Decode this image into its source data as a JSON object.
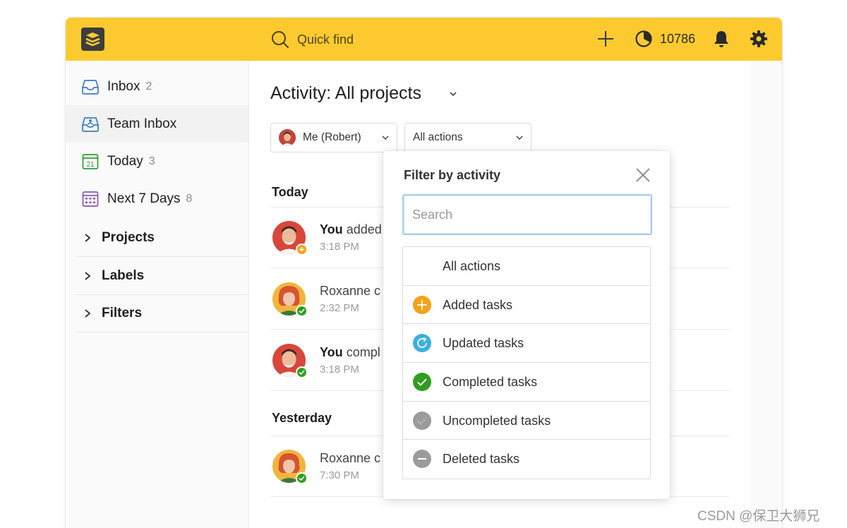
{
  "topbar": {
    "search_label": "Quick find",
    "karma_score": "10786"
  },
  "sidebar": {
    "items": [
      {
        "label": "Inbox",
        "count": "2",
        "icon": "inbox-icon"
      },
      {
        "label": "Team Inbox",
        "count": "",
        "icon": "team-inbox-icon"
      },
      {
        "label": "Today",
        "count": "3",
        "icon": "calendar-today-icon",
        "day_number": "21"
      },
      {
        "label": "Next 7 Days",
        "count": "8",
        "icon": "calendar-week-icon"
      }
    ],
    "sections": [
      {
        "label": "Projects"
      },
      {
        "label": "Labels"
      },
      {
        "label": "Filters"
      }
    ]
  },
  "main": {
    "title": "Activity: All projects",
    "user_filter": "Me (Robert)",
    "action_filter": "All actions",
    "groups": [
      {
        "heading": "Today",
        "rows": [
          {
            "actor": "You",
            "text": "added",
            "time": "3:18 PM",
            "badge": "added",
            "avatar": "robert"
          },
          {
            "actor": "",
            "text": "Roxanne c",
            "time": "2:32 PM",
            "badge": "completed",
            "avatar": "roxanne"
          },
          {
            "actor": "You",
            "text": "compl",
            "time": "3:18 PM",
            "badge": "completed",
            "avatar": "robert"
          }
        ]
      },
      {
        "heading": "Yesterday",
        "rows": [
          {
            "actor": "",
            "text": "Roxanne c",
            "time": "7:30 PM",
            "badge": "completed",
            "avatar": "roxanne"
          }
        ]
      }
    ]
  },
  "popup": {
    "title": "Filter by activity",
    "search_placeholder": "Search",
    "actions": [
      {
        "label": "All actions",
        "icon": "none"
      },
      {
        "label": "Added tasks",
        "icon": "plus-circle-icon",
        "color": "#f4a21a"
      },
      {
        "label": "Updated tasks",
        "icon": "refresh-circle-icon",
        "color": "#3ab0e2"
      },
      {
        "label": "Completed tasks",
        "icon": "check-circle-icon",
        "color": "#2f9e1e"
      },
      {
        "label": "Uncompleted tasks",
        "icon": "uncheck-circle-icon",
        "color": "#9b9b9b"
      },
      {
        "label": "Deleted tasks",
        "icon": "minus-circle-icon",
        "color": "#9b9b9b"
      }
    ]
  },
  "colors": {
    "topbar": "#fcca2f",
    "added": "#f4a21a",
    "completed": "#2f9e1e",
    "updated": "#3ab0e2",
    "neutral": "#9b9b9b"
  },
  "watermark": "CSDN @保卫大狮兄"
}
